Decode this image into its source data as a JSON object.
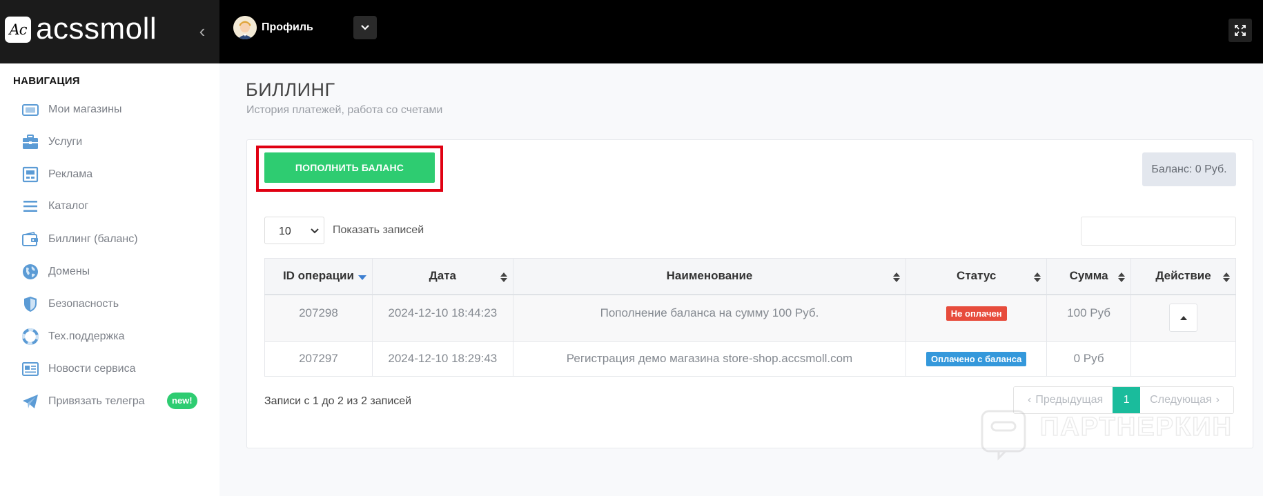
{
  "header": {
    "logo_mark": "Ac",
    "logo_text": "acssmoll",
    "profile_label": "Профиль"
  },
  "sidebar": {
    "title": "НАВИГАЦИЯ",
    "items": [
      {
        "label": "Мои магазины",
        "icon": "wallet-card-icon"
      },
      {
        "label": "Услуги",
        "icon": "briefcase-icon"
      },
      {
        "label": "Реклама",
        "icon": "billboard-icon"
      },
      {
        "label": "Каталог",
        "icon": "list-icon"
      },
      {
        "label": "Биллинг (баланс)",
        "icon": "wallet-icon"
      },
      {
        "label": "Домены",
        "icon": "globe-icon"
      },
      {
        "label": "Безопасность",
        "icon": "shield-icon"
      },
      {
        "label": "Тех.поддержка",
        "icon": "lifebuoy-icon"
      },
      {
        "label": "Новости сервиса",
        "icon": "newspaper-icon"
      },
      {
        "label": "Привязать телегра",
        "icon": "telegram-icon",
        "badge": "new!"
      }
    ]
  },
  "page": {
    "title": "БИЛЛИНГ",
    "subtitle": "История платежей, работа со счетами"
  },
  "billing": {
    "topup_label": "ПОПОЛНИТЬ БАЛАНС",
    "balance": "Баланс: 0 Руб.",
    "page_length": "10",
    "page_length_label": "Показать записей",
    "search_value": ""
  },
  "table": {
    "columns": [
      "ID операции",
      "Дата",
      "Наименование",
      "Статус",
      "Сумма",
      "Действие"
    ],
    "rows": [
      {
        "id": "207298",
        "date": "2024-12-10 18:44:23",
        "name": "Пополнение баланса на сумму 100 Руб.",
        "status": "Не оплачен",
        "amount": "100 Руб"
      },
      {
        "id": "207297",
        "date": "2024-12-10 18:29:43",
        "name": "Регистрация демо магазина store-shop.accsmoll.com",
        "status": "Оплачено с баланса",
        "amount": "0 Руб"
      }
    ]
  },
  "footer": {
    "info": "Записи с 1 до 2 из 2 записей",
    "prev": "Предыдущая",
    "current_page": "1",
    "next": "Следующая"
  },
  "watermark": "ПАРТНЕРКИН",
  "colors": {
    "accent_green": "#2ecc71",
    "page_active": "#1abc9c",
    "status_unpaid": "#e74c3c",
    "status_paid": "#3498db",
    "highlight_red": "#e00012",
    "icon_blue": "#5b9bd5"
  }
}
